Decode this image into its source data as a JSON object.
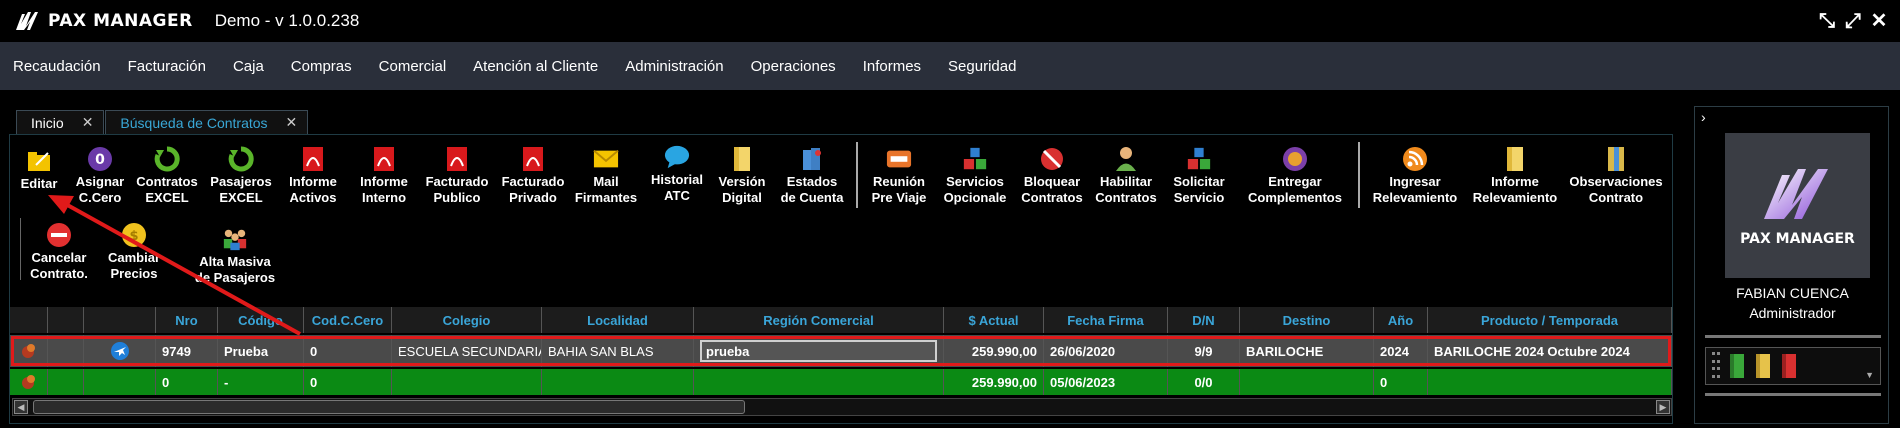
{
  "app": {
    "brand": "PAX MANAGER",
    "version_label": "Demo - v 1.0.0.238"
  },
  "window_controls": [
    "restore-icon",
    "maximize-icon",
    "close-icon"
  ],
  "menu": [
    "Recaudación",
    "Facturación",
    "Caja",
    "Compras",
    "Comercial",
    "Atención al Cliente",
    "Administración",
    "Operaciones",
    "Informes",
    "Seguridad"
  ],
  "tabs": [
    {
      "label": "Inicio",
      "active": false
    },
    {
      "label": "Búsqueda de Contratos",
      "active": true
    }
  ],
  "toolbar": [
    {
      "line1": "Editar",
      "line2": "",
      "icon": "edit-folder-icon"
    },
    {
      "line1": "Asignar",
      "line2": "C.Cero",
      "icon": "zero-icon"
    },
    {
      "line1": "Contratos",
      "line2": "EXCEL",
      "icon": "refresh-green-icon"
    },
    {
      "line1": "Pasajeros",
      "line2": "EXCEL",
      "icon": "refresh-green-icon"
    },
    {
      "line1": "Informe",
      "line2": "Activos",
      "icon": "pdf-icon"
    },
    {
      "line1": "Informe",
      "line2": "Interno",
      "icon": "pdf-icon"
    },
    {
      "line1": "Facturado",
      "line2": "Publico",
      "icon": "pdf-icon"
    },
    {
      "line1": "Facturado",
      "line2": "Privado",
      "icon": "pdf-icon"
    },
    {
      "line1": "Mail",
      "line2": "Firmantes",
      "icon": "mail-icon"
    },
    {
      "line1": "Historial",
      "line2": "ATC",
      "icon": "chat-bubble-icon"
    },
    {
      "line1": "Versión",
      "line2": "Digital",
      "icon": "document-icon"
    },
    {
      "line1": "Estados",
      "line2": "de Cuenta",
      "icon": "account-book-icon"
    },
    {
      "line1": "Reunión",
      "line2": "Pre Viaje",
      "icon": "meeting-icon"
    },
    {
      "line1": "Servicios",
      "line2": "Opcionale",
      "icon": "cubes-icon"
    },
    {
      "line1": "Bloquear",
      "line2": "Contratos",
      "icon": "block-icon"
    },
    {
      "line1": "Habilitar",
      "line2": "Contratos",
      "icon": "user-enable-icon"
    },
    {
      "line1": "Solicitar",
      "line2": "Servicio",
      "icon": "cubes-icon"
    },
    {
      "line1": "Entregar",
      "line2": "Complementos",
      "icon": "deliver-icon"
    },
    {
      "line1": "Ingresar",
      "line2": "Relevamiento",
      "icon": "rss-icon"
    },
    {
      "line1": "Informe",
      "line2": "Relevamiento",
      "icon": "document-icon"
    },
    {
      "line1": "Observaciones",
      "line2": "Contrato",
      "icon": "notes-icon"
    },
    {
      "line1": "Cancelar",
      "line2": "Contrato.",
      "icon": "cancel-icon"
    },
    {
      "line1": "Cambiar",
      "line2": "Precios",
      "icon": "coin-icon"
    },
    {
      "line1": "Alta Masiva",
      "line2": "de Pasajeros",
      "icon": "group-users-icon"
    }
  ],
  "grid": {
    "headers": [
      "",
      "",
      "",
      "Nro",
      "Código",
      "Cod.C.Cero",
      "Colegio",
      "Localidad",
      "Región Comercial",
      "$ Actual",
      "Fecha Firma",
      "D/N",
      "Destino",
      "Año",
      "Producto / Temporada"
    ],
    "rows": [
      {
        "nro": "9749",
        "codigo": "Prueba",
        "cod_cero": "0",
        "colegio": "ESCUELA SECUNDARIA I",
        "localidad": "BAHIA SAN BLAS",
        "region": "prueba",
        "actual": "259.990,00",
        "fecha": "26/06/2020",
        "dn": "9/9",
        "destino": "BARILOCHE",
        "anio": "2024",
        "producto": "BARILOCHE 2024 Octubre 2024"
      },
      {
        "nro": "0",
        "codigo": "-",
        "cod_cero": "0",
        "colegio": "",
        "localidad": "",
        "region": "",
        "actual": "259.990,00",
        "fecha": "05/06/2023",
        "dn": "0/0",
        "destino": "",
        "anio": "0",
        "producto": ""
      }
    ]
  },
  "user": {
    "name": "FABIAN CUENCA",
    "role": "Administrador"
  },
  "colors": {
    "menu_bg": "#2a2f3a",
    "accent_blue": "#39a7d6",
    "highlight_red": "#e01a1a",
    "total_row_green": "#0b8a14"
  }
}
